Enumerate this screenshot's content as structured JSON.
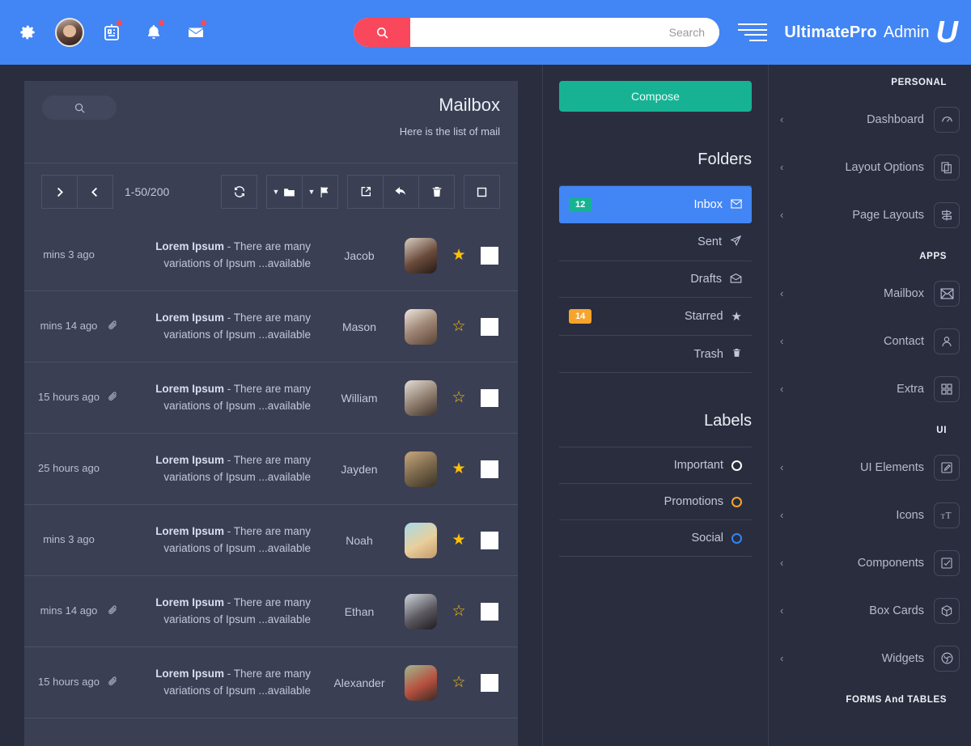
{
  "header": {
    "icons": [
      {
        "name": "gear-icon",
        "badge": false
      },
      {
        "name": "user-avatar",
        "badge": false
      },
      {
        "name": "calendar-icon",
        "badge": true
      },
      {
        "name": "bell-icon",
        "badge": true
      },
      {
        "name": "envelope-icon",
        "badge": true
      }
    ],
    "search": {
      "placeholder": "Search",
      "value": "",
      "button_icon": "search-icon"
    },
    "menu_icon": "hamburger-icon",
    "brand_name": "UltimatePro",
    "brand_sub": "Admin",
    "brand_logo": "U",
    "bar_color": "#4285f4",
    "search_button_color": "#f9485b"
  },
  "mailbox": {
    "title": "Mailbox",
    "subtitle": "Here is the list of mail",
    "search_icon": "search-icon",
    "pagination": {
      "next_icon": "chevron-right-icon",
      "prev_icon": "chevron-left-icon",
      "count": "1-50/200"
    },
    "tools": [
      {
        "name": "refresh-button",
        "icon": "refresh-icon"
      },
      {
        "name": "folder-dropdown-button",
        "icon": "folder-icon"
      },
      {
        "name": "flag-dropdown-button",
        "icon": "flag-icon"
      },
      {
        "name": "forward-button",
        "icon": "share-icon"
      },
      {
        "name": "reply-button",
        "icon": "reply-icon"
      },
      {
        "name": "delete-button",
        "icon": "trash-icon"
      },
      {
        "name": "select-button",
        "icon": "square-icon"
      }
    ],
    "rows": [
      {
        "time": "mins 3 ago",
        "clip": false,
        "subject_title": "Lorem Ipsum",
        "subject_text": "- There are many variations of Ipsum ...available",
        "name": "Jacob",
        "starred": true,
        "checked": false
      },
      {
        "time": "mins 14 ago",
        "clip": true,
        "subject_title": "Lorem Ipsum",
        "subject_text": "- There are many variations of Ipsum ...available",
        "name": "Mason",
        "starred": false,
        "checked": false
      },
      {
        "time": "15 hours ago",
        "clip": true,
        "subject_title": "Lorem Ipsum",
        "subject_text": "- There are many variations of Ipsum ...available",
        "name": "William",
        "starred": false,
        "checked": false
      },
      {
        "time": "25 hours ago",
        "clip": false,
        "subject_title": "Lorem Ipsum",
        "subject_text": "- There are many variations of Ipsum ...available",
        "name": "Jayden",
        "starred": true,
        "checked": false
      },
      {
        "time": "mins 3 ago",
        "clip": false,
        "subject_title": "Lorem Ipsum",
        "subject_text": "- There are many variations of Ipsum ...available",
        "name": "Noah",
        "starred": true,
        "checked": false
      },
      {
        "time": "mins 14 ago",
        "clip": true,
        "subject_title": "Lorem Ipsum",
        "subject_text": "- There are many variations of Ipsum ...available",
        "name": "Ethan",
        "starred": false,
        "checked": false
      },
      {
        "time": "15 hours ago",
        "clip": true,
        "subject_title": "Lorem Ipsum",
        "subject_text": "- There are many variations of Ipsum ...available",
        "name": "Alexander",
        "starred": false,
        "checked": false
      }
    ]
  },
  "folders_panel": {
    "compose_label": "Compose",
    "compose_color": "#17b294",
    "folders_title": "Folders",
    "folders": [
      {
        "label": "Inbox",
        "icon": "envelope-icon",
        "badge": "12",
        "badge_color": "#17b294",
        "active": true
      },
      {
        "label": "Sent",
        "icon": "paper-plane-icon",
        "badge": "",
        "active": false
      },
      {
        "label": "Drafts",
        "icon": "envelope-open-icon",
        "badge": "",
        "active": false
      },
      {
        "label": "Starred",
        "icon": "star-icon",
        "badge": "14",
        "badge_color": "#f7a42b",
        "active": false
      },
      {
        "label": "Trash",
        "icon": "trash-icon",
        "badge": "",
        "active": false
      }
    ],
    "labels_title": "Labels",
    "labels": [
      {
        "label": "Important",
        "color": "#ffffff"
      },
      {
        "label": "Promotions",
        "color": "#f7a42b"
      },
      {
        "label": "Social",
        "color": "#2f86f6"
      }
    ]
  },
  "sidebar": {
    "sections": [
      {
        "heading": "PERSONAL",
        "items": [
          {
            "label": "Dashboard",
            "icon": "speedometer-icon"
          },
          {
            "label": "Layout Options",
            "icon": "copy-icon"
          },
          {
            "label": "Page Layouts",
            "icon": "signpost-icon"
          }
        ]
      },
      {
        "heading": "APPS",
        "items": [
          {
            "label": "Mailbox",
            "icon": "envelope-icon"
          },
          {
            "label": "Contact",
            "icon": "user-icon"
          },
          {
            "label": "Extra",
            "icon": "grid-icon"
          }
        ]
      },
      {
        "heading": "UI",
        "items": [
          {
            "label": "UI Elements",
            "icon": "pencil-square-icon"
          },
          {
            "label": "Icons",
            "icon": "text-size-icon"
          },
          {
            "label": "Components",
            "icon": "check-square-icon"
          },
          {
            "label": "Box Cards",
            "icon": "box-icon"
          },
          {
            "label": "Widgets",
            "icon": "widget-icon"
          }
        ]
      },
      {
        "heading": "FORMS And TABLES",
        "items": []
      }
    ],
    "chevron_icon": "chevron-left-icon"
  }
}
